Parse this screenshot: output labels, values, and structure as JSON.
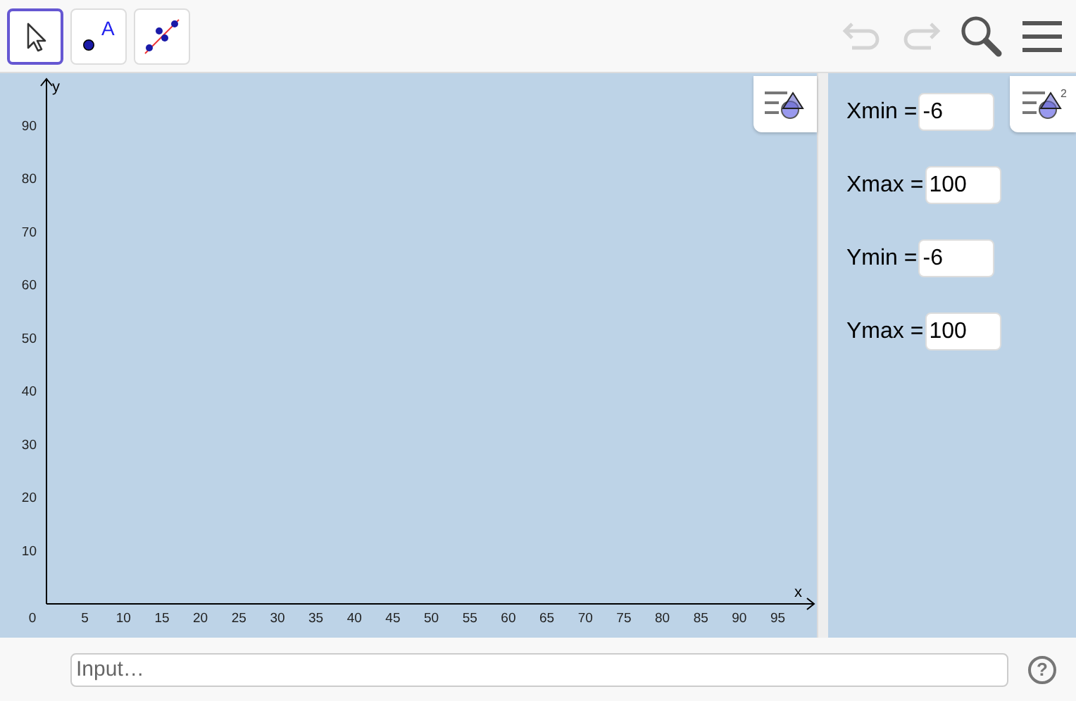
{
  "toolbar": {
    "tools": [
      {
        "kind": "move",
        "selected": true
      },
      {
        "kind": "point",
        "selected": false,
        "letter": "A"
      },
      {
        "kind": "fit-line",
        "selected": false
      }
    ],
    "undo": {
      "disabled": true
    },
    "redo": {
      "disabled": true
    }
  },
  "graphics": {
    "y_axis_label": "y",
    "x_axis_label": "x",
    "origin_label": "0",
    "x_ticks": [
      "5",
      "10",
      "15",
      "20",
      "25",
      "30",
      "35",
      "40",
      "45",
      "50",
      "55",
      "60",
      "65",
      "70",
      "75",
      "80",
      "85",
      "90",
      "95"
    ],
    "y_ticks": [
      "90",
      "80",
      "70",
      "60",
      "50",
      "40",
      "30",
      "20",
      "10"
    ]
  },
  "side_panel": {
    "fields": [
      {
        "label": "Xmin =",
        "value": "-6"
      },
      {
        "label": "Xmax =",
        "value": "100"
      },
      {
        "label": "Ymin =",
        "value": "-6"
      },
      {
        "label": "Ymax =",
        "value": "100"
      }
    ],
    "style_bar_badge": "2"
  },
  "input_bar": {
    "placeholder": "Input…",
    "help": "?"
  }
}
